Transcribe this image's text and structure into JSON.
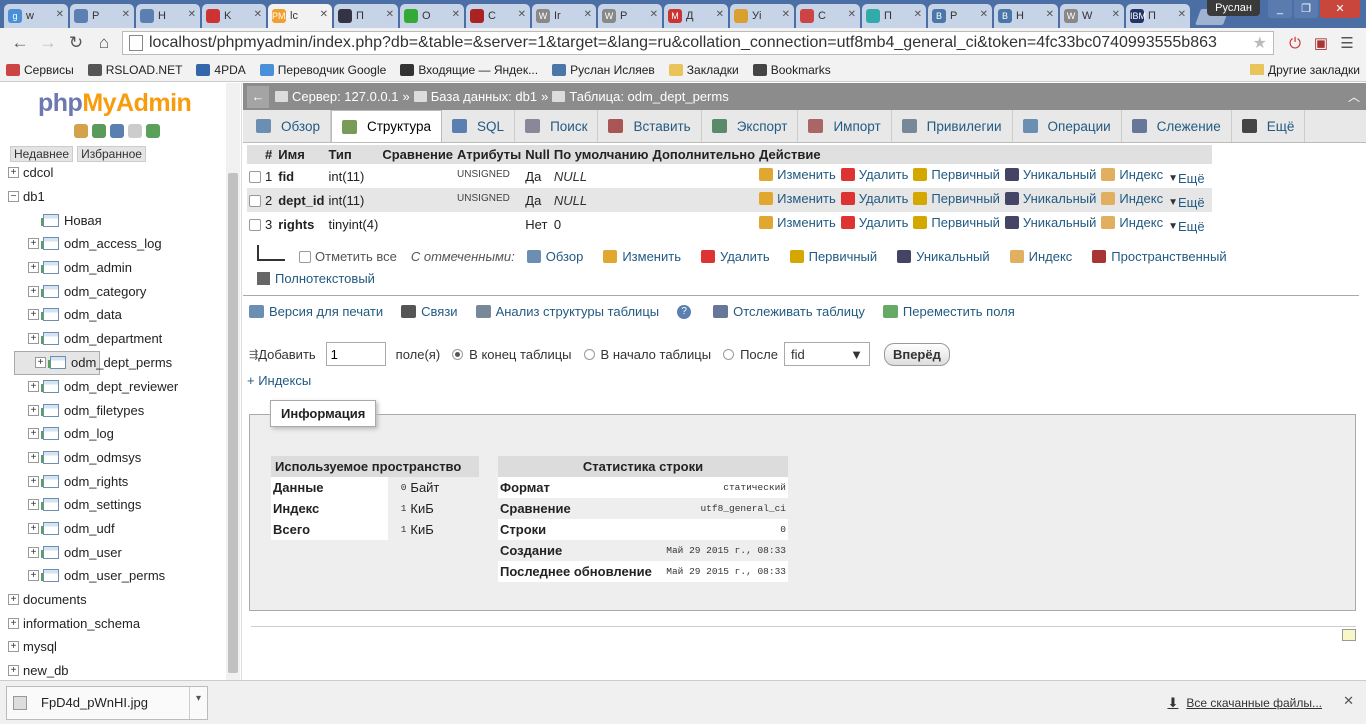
{
  "browser": {
    "tabs": [
      {
        "label": "w",
        "fav": "g",
        "color": "#4a90d9"
      },
      {
        "label": "P",
        "fav": "",
        "color": "#5a7fb0"
      },
      {
        "label": "H",
        "fav": "",
        "color": "#5a7fb0"
      },
      {
        "label": "K",
        "fav": "",
        "color": "#c33"
      },
      {
        "label": "lc",
        "fav": "PMA",
        "color": "#f0a030"
      },
      {
        "label": "П",
        "fav": "",
        "color": "#334"
      },
      {
        "label": "О",
        "fav": "",
        "color": "#3a3"
      },
      {
        "label": "С",
        "fav": "",
        "color": "#a22"
      },
      {
        "label": "Ir",
        "fav": "W",
        "color": "#888"
      },
      {
        "label": "Р",
        "fav": "W",
        "color": "#888"
      },
      {
        "label": "Д",
        "fav": "M",
        "color": "#c33"
      },
      {
        "label": "Уі",
        "fav": "",
        "color": "#d9a030"
      },
      {
        "label": "С",
        "fav": "",
        "color": "#c44"
      },
      {
        "label": "П",
        "fav": "",
        "color": "#3aa"
      },
      {
        "label": "Р",
        "fav": "B",
        "color": "#4a76a8"
      },
      {
        "label": "Н",
        "fav": "B",
        "color": "#4a76a8"
      },
      {
        "label": "W",
        "fav": "W",
        "color": "#888"
      },
      {
        "label": "П",
        "fav": "IBM",
        "color": "#236"
      }
    ],
    "user": "Руслан",
    "url": "localhost/phpmyadmin/index.php?db=&table=&server=1&target=&lang=ru&collation_connection=utf8mb4_general_ci&token=4fc33bc0740993555b863",
    "bookmarks": [
      {
        "label": "Сервисы",
        "color": "#c44"
      },
      {
        "label": "RSLOAD.NET",
        "color": "#555"
      },
      {
        "label": "4PDA",
        "color": "#36a"
      },
      {
        "label": "Переводчик Google",
        "color": "#4a90d9"
      },
      {
        "label": "Входящие — Яндек...",
        "color": "#333"
      },
      {
        "label": "Руслан Исляев",
        "color": "#4a76a8"
      },
      {
        "label": "Закладки",
        "color": "#e8c45a"
      },
      {
        "label": "Bookmarks",
        "color": "#444"
      }
    ],
    "other_bookmarks": "Другие закладки"
  },
  "sidebar": {
    "logo_a": "php",
    "logo_b": "MyAdmin",
    "tab_recent": "Недавнее",
    "tab_fav": "Избранное",
    "tree": [
      {
        "label": "cdcol",
        "level": 0,
        "exp": "+"
      },
      {
        "label": "db1",
        "level": 0,
        "exp": "−"
      },
      {
        "label": "Новая",
        "level": 1,
        "kind": "new"
      },
      {
        "label": "odm_access_log",
        "level": 1
      },
      {
        "label": "odm_admin",
        "level": 1
      },
      {
        "label": "odm_category",
        "level": 1
      },
      {
        "label": "odm_data",
        "level": 1
      },
      {
        "label": "odm_department",
        "level": 1
      },
      {
        "label": "odm_dept_perms",
        "level": 1,
        "selected": true
      },
      {
        "label": "odm_dept_reviewer",
        "level": 1
      },
      {
        "label": "odm_filetypes",
        "level": 1
      },
      {
        "label": "odm_log",
        "level": 1
      },
      {
        "label": "odm_odmsys",
        "level": 1
      },
      {
        "label": "odm_rights",
        "level": 1
      },
      {
        "label": "odm_settings",
        "level": 1
      },
      {
        "label": "odm_udf",
        "level": 1
      },
      {
        "label": "odm_user",
        "level": 1
      },
      {
        "label": "odm_user_perms",
        "level": 1
      },
      {
        "label": "documents",
        "level": 0,
        "exp": "+"
      },
      {
        "label": "information_schema",
        "level": 0,
        "exp": "+"
      },
      {
        "label": "mysql",
        "level": 0,
        "exp": "+"
      },
      {
        "label": "new_db",
        "level": 0,
        "exp": "+"
      }
    ]
  },
  "breadcrumb": {
    "server": "Сервер: 127.0.0.1",
    "db": "База данных: db1",
    "table": "Таблица: odm_dept_perms"
  },
  "menu": [
    {
      "label": "Обзор",
      "color": "#6a8fb3"
    },
    {
      "label": "Структура",
      "color": "#7a9a5a",
      "active": true
    },
    {
      "label": "SQL",
      "color": "#5a7fb0"
    },
    {
      "label": "Поиск",
      "color": "#889"
    },
    {
      "label": "Вставить",
      "color": "#a55"
    },
    {
      "label": "Экспорт",
      "color": "#5a8a6a"
    },
    {
      "label": "Импорт",
      "color": "#a66"
    },
    {
      "label": "Привилегии",
      "color": "#789"
    },
    {
      "label": "Операции",
      "color": "#6a8fb3"
    },
    {
      "label": "Слежение",
      "color": "#679"
    },
    {
      "label": "Ещё",
      "color": "#444"
    }
  ],
  "structure": {
    "headers": [
      "#",
      "Имя",
      "Тип",
      "Сравнение",
      "Атрибуты",
      "Null",
      "По умолчанию",
      "Дополнительно",
      "Действие"
    ],
    "rows": [
      {
        "num": "1",
        "name": "fid",
        "type": "int(11)",
        "collation": "",
        "attr": "UNSIGNED",
        "null": "Да",
        "default": "NULL",
        "extra": ""
      },
      {
        "num": "2",
        "name": "dept_id",
        "type": "int(11)",
        "collation": "",
        "attr": "UNSIGNED",
        "null": "Да",
        "default": "NULL",
        "extra": ""
      },
      {
        "num": "3",
        "name": "rights",
        "type": "tinyint(4)",
        "collation": "",
        "attr": "",
        "null": "Нет",
        "default": "0",
        "extra": ""
      }
    ],
    "actions": {
      "edit": "Изменить",
      "drop": "Удалить",
      "primary": "Первичный",
      "unique": "Уникальный",
      "index": "Индекс",
      "more": "Ещё"
    }
  },
  "with_selected": {
    "check_all": "Отметить все",
    "label": "С отмеченными:",
    "items": [
      "Обзор",
      "Изменить",
      "Удалить",
      "Первичный",
      "Уникальный",
      "Индекс",
      "Пространственный"
    ],
    "fulltext": "Полнотекстовый"
  },
  "links": [
    "Версия для печати",
    "Связи",
    "Анализ структуры таблицы",
    "Отслеживать таблицу",
    "Переместить поля"
  ],
  "add": {
    "label": "Добавить",
    "count": "1",
    "fields": "поле(я)",
    "opt_end": "В конец таблицы",
    "opt_start": "В начало таблицы",
    "opt_after": "После",
    "after_col": "fid",
    "go": "Вперёд"
  },
  "indexes_link": "+ Индексы",
  "info": {
    "legend": "Информация",
    "space_title": "Используемое пространство",
    "space": [
      {
        "label": "Данные",
        "value": "0",
        "unit": "Байт"
      },
      {
        "label": "Индекс",
        "value": "1",
        "unit": "КиБ"
      },
      {
        "label": "Всего",
        "value": "1",
        "unit": "КиБ"
      }
    ],
    "stats_title": "Статистика строки",
    "stats": [
      {
        "label": "Формат",
        "value": "статический"
      },
      {
        "label": "Сравнение",
        "value": "utf8_general_ci"
      },
      {
        "label": "Строки",
        "value": "0"
      },
      {
        "label": "Создание",
        "value": "Май 29 2015 г., 08:33"
      },
      {
        "label": "Последнее обновление",
        "value": "Май 29 2015 г., 08:33"
      }
    ]
  },
  "downloads": {
    "file": "FpD4d_pWnHI.jpg",
    "all": "Все скачанные файлы..."
  }
}
